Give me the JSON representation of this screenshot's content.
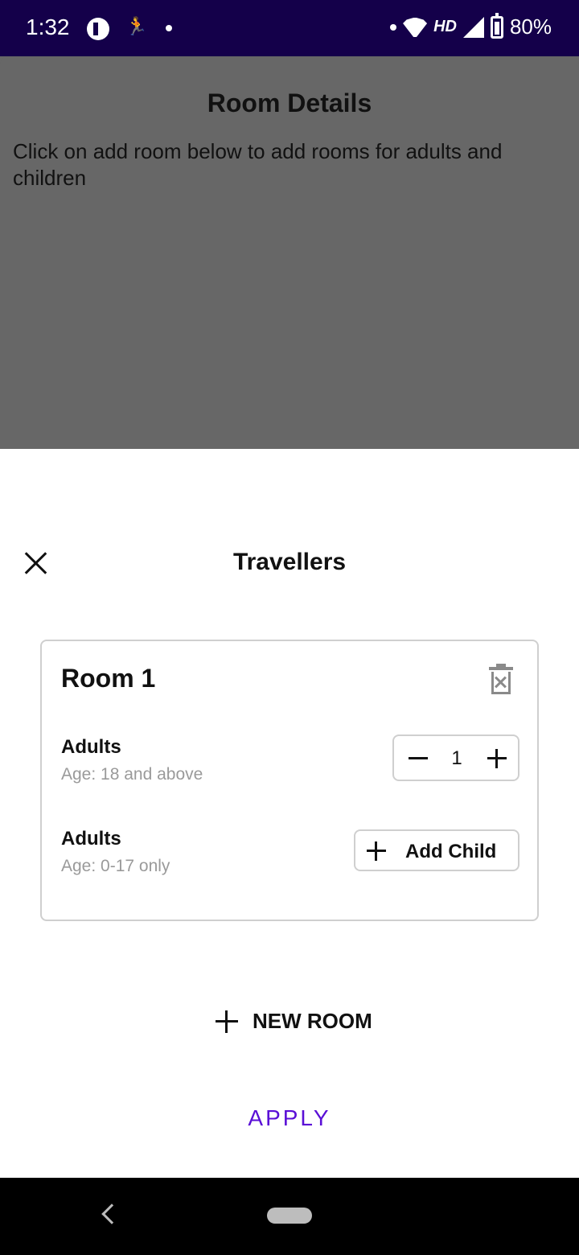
{
  "status_bar": {
    "time": "1:32",
    "network": "HD",
    "battery": "80%"
  },
  "background_page": {
    "title": "Room Details",
    "description": "Click on add room below to add rooms for adults and children"
  },
  "sheet": {
    "title": "Travellers",
    "room": {
      "title": "Room 1",
      "adults": {
        "label": "Adults",
        "sub": "Age: 18 and above",
        "count": "1"
      },
      "children": {
        "label": "Adults",
        "sub": "Age: 0-17 only",
        "button": "Add Child"
      }
    },
    "new_room_label": "NEW ROOM",
    "apply_label": "APPLY"
  },
  "colors": {
    "status_bar": "#14004a",
    "accent": "#5a0fd6",
    "backdrop": "#676767"
  }
}
